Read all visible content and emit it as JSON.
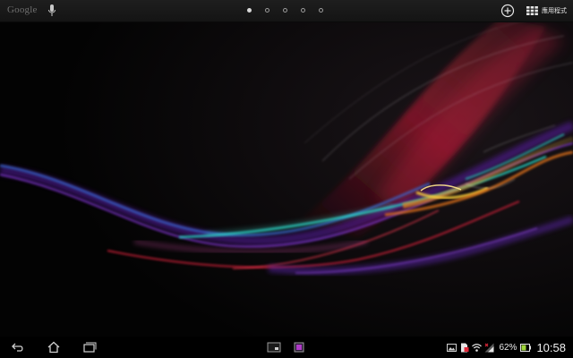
{
  "search_bar": {
    "google_label": "Google",
    "mic_icon": "mic-icon"
  },
  "page_indicator": {
    "total_pages": 5,
    "active_index": 0
  },
  "actions": {
    "add_icon": "add-icon",
    "apps_icon": "apps-grid-icon",
    "apps_label": "應用程式"
  },
  "nav_bar": {
    "back_icon": "back-icon",
    "home_icon": "home-icon",
    "recents_icon": "recent-apps-icon"
  },
  "recent_apps": [
    {
      "icon": "app-thumbnail-icon"
    },
    {
      "icon": "app-thumbnail-icon"
    }
  ],
  "status": {
    "icons": [
      "photo-notification-icon",
      "sim-card-icon",
      "wifi-icon",
      "signal-icon"
    ],
    "battery_percent": "62%",
    "time": "10:58"
  },
  "colors": {
    "accent_red": "#e0283a",
    "accent_orange": "#f2a01e",
    "accent_cyan": "#25d6c6",
    "accent_purple": "#9b3cf0",
    "battery_green": "#9fd63a"
  }
}
